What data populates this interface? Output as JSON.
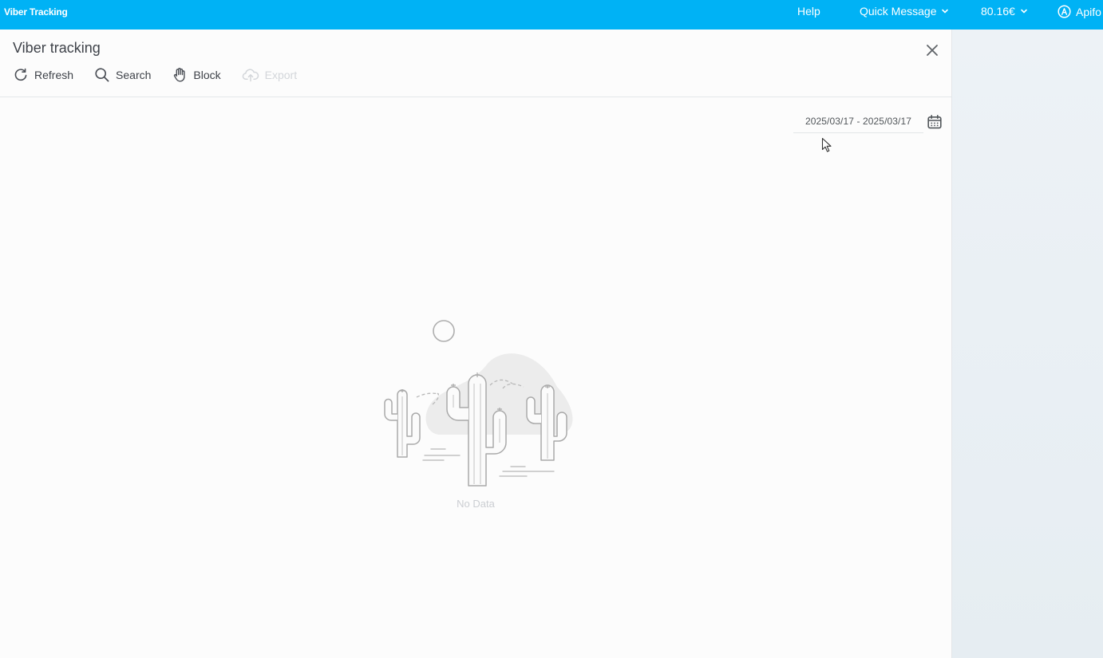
{
  "topbar": {
    "app_title": "Viber Tracking",
    "help": "Help",
    "quick_message": "Quick Message",
    "balance": "80.16€",
    "user": "Apifo",
    "accent_color": "#00b2f5"
  },
  "panel": {
    "title": "Viber tracking",
    "toolbar": {
      "refresh": "Refresh",
      "search": "Search",
      "block": "Block",
      "export": "Export"
    },
    "date_range": "2025/03/17 - 2025/03/17",
    "empty_text": "No Data"
  },
  "icons": [
    "refresh-icon",
    "search-icon",
    "hand-icon",
    "cloud-upload-icon",
    "close-icon",
    "calendar-icon",
    "chevron-down-icon",
    "user-circle-icon",
    "mouse-pointer-icon",
    "empty-desert-illustration"
  ]
}
